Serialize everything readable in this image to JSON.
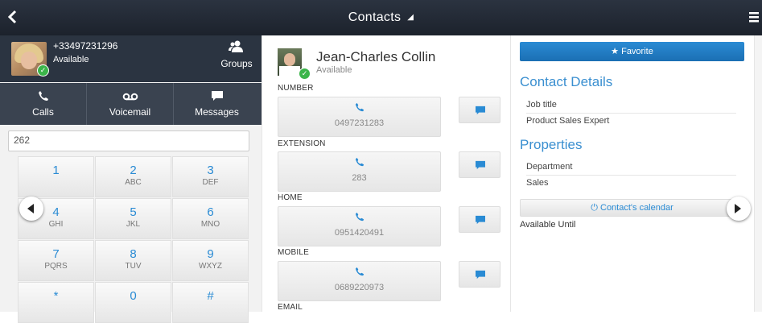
{
  "header": {
    "title": "Contacts"
  },
  "profile": {
    "phone": "+33497231296",
    "status": "Available",
    "groups_label": "Groups"
  },
  "nav": {
    "calls": "Calls",
    "voicemail": "Voicemail",
    "messages": "Messages"
  },
  "dialer": {
    "input_value": "262",
    "keys": [
      {
        "digit": "1",
        "letters": ""
      },
      {
        "digit": "2",
        "letters": "ABC"
      },
      {
        "digit": "3",
        "letters": "DEF"
      },
      {
        "digit": "4",
        "letters": "GHI"
      },
      {
        "digit": "5",
        "letters": "JKL"
      },
      {
        "digit": "6",
        "letters": "MNO"
      },
      {
        "digit": "7",
        "letters": "PQRS"
      },
      {
        "digit": "8",
        "letters": "TUV"
      },
      {
        "digit": "9",
        "letters": "WXYZ"
      },
      {
        "digit": "*",
        "letters": ""
      },
      {
        "digit": "0",
        "letters": ""
      },
      {
        "digit": "#",
        "letters": ""
      }
    ]
  },
  "contact": {
    "name": "Jean-Charles Collin",
    "status": "Available",
    "numbers": [
      {
        "label": "NUMBER",
        "value": "0497231283"
      },
      {
        "label": "EXTENSION",
        "value": "283"
      },
      {
        "label": "HOME",
        "value": "0951420491"
      },
      {
        "label": "MOBILE",
        "value": "0689220973"
      }
    ],
    "email_label": "EMAIL"
  },
  "details": {
    "favorite": "Favorite",
    "contact_details_title": "Contact Details",
    "job_title_label": "Job title",
    "job_title_value": "Product Sales Expert",
    "properties_title": "Properties",
    "department_label": "Department",
    "department_value": "Sales",
    "calendar_button": "Contact's calendar",
    "available_until": "Available Until"
  },
  "colors": {
    "accent": "#2a8bd4",
    "topbar": "#232a35",
    "status_green": "#3bb54a"
  }
}
